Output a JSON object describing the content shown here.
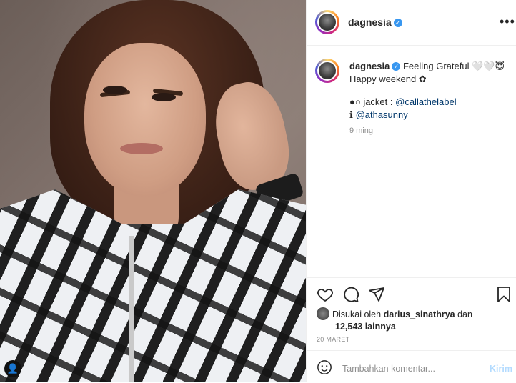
{
  "post": {
    "username": "dagnesia",
    "verified_mark": "✓",
    "more_label": "•••",
    "caption_lines": [
      "Feeling Grateful 🤍🤍😇",
      "Happy weekend ✿"
    ],
    "credit_jacket_prefix": "●○ jacket : ",
    "credit_jacket_handle": "@callathelabel",
    "credit_photo_prefix": "ℹ ",
    "credit_photo_handle": "@athasunny",
    "time_ago": "9 ming",
    "liked_by_prefix": "Disukai oleh ",
    "liked_by_user": "darius_sinathrya",
    "liked_by_and": " dan",
    "liked_by_count": "12,543 lainnya",
    "date": "20 MARET",
    "comment_placeholder": "Tambahkan komentar...",
    "send_label": "Kirim",
    "photo_user_icon": "👤"
  },
  "icons": [
    "heart-icon",
    "comment-icon",
    "share-icon",
    "bookmark-icon",
    "emoji-icon",
    "more-icon",
    "verified-icon"
  ],
  "colors": {
    "accent": "#3897f0",
    "link": "#00376b",
    "muted": "#8e8e8e",
    "border": "#efefef"
  }
}
